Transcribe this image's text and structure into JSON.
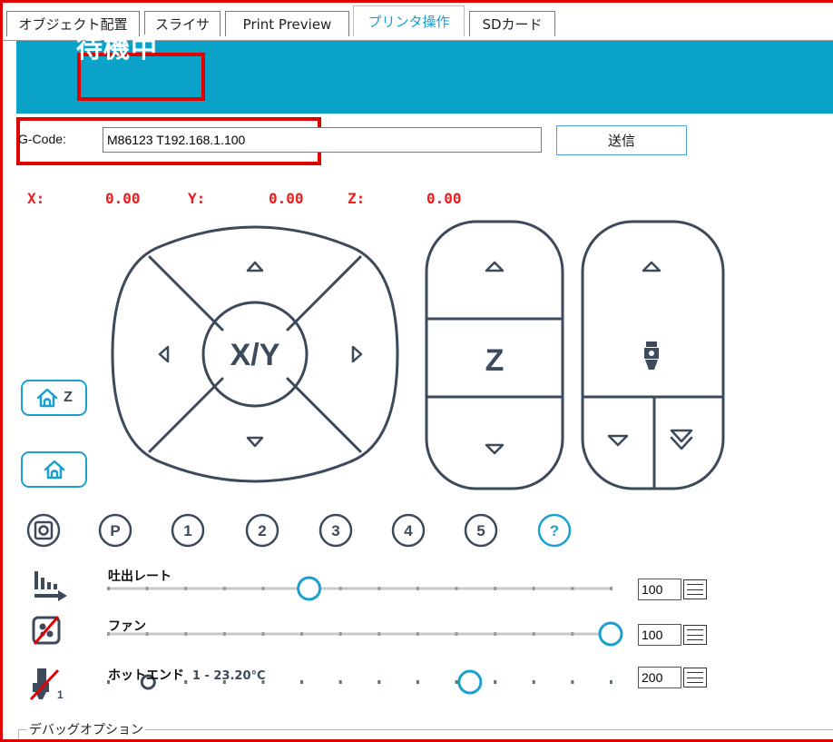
{
  "tabs": [
    {
      "label": "オブジェクト配置"
    },
    {
      "label": "スライサ"
    },
    {
      "label": "Print Preview"
    },
    {
      "label": "プリンタ操作",
      "active": true
    },
    {
      "label": "SDカード"
    }
  ],
  "status": {
    "text": "待機中"
  },
  "gcode": {
    "label": "G-Code:",
    "value": "M86123 T192.168.1.100",
    "send_label": "送信"
  },
  "coordinates": {
    "x_label": "X:",
    "x_value": "0.00",
    "y_label": "Y:",
    "y_value": "0.00",
    "z_label": "Z:",
    "z_value": "0.00"
  },
  "jog": {
    "xy_label": "X/Y",
    "z_label": "Z"
  },
  "home": {
    "home_z_label": "Z"
  },
  "presets": [
    "P",
    "1",
    "2",
    "3",
    "4",
    "5",
    "?"
  ],
  "sliders": {
    "flow": {
      "label": "吐出レート",
      "value": "100",
      "fraction": 0.4
    },
    "fan": {
      "label": "ファン",
      "value": "100",
      "fraction": 1.0
    },
    "hotend": {
      "label": "ホットエンド",
      "reading": "1 - 23.20°C",
      "value": "200",
      "fraction": 0.72,
      "current_fraction": 0.08
    },
    "extruder_index": "1"
  },
  "debug": {
    "label": "デバッグオプション"
  },
  "colors": {
    "accent": "#0aa2c9",
    "highlight": "#e00000",
    "coord_red": "#ef1d1d",
    "icon_stroke": "#3c4a5c",
    "icon_blue": "#1aa0d0"
  }
}
